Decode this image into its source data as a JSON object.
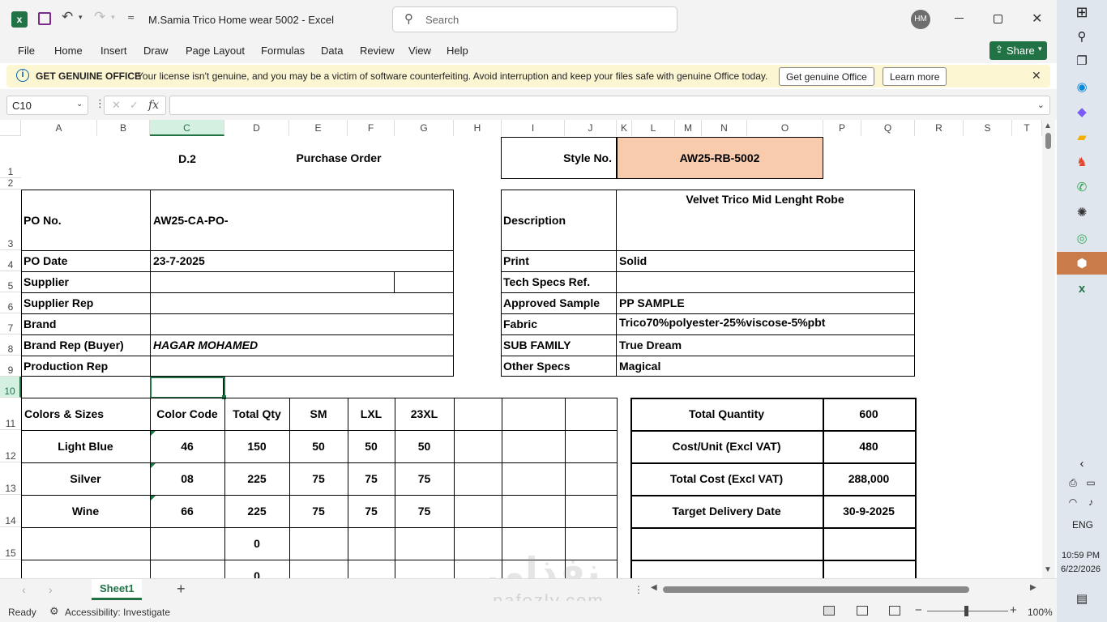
{
  "window": {
    "title": "M.Samia Trico Home wear 5002  -  Excel",
    "search_placeholder": "Search",
    "avatar": "HM"
  },
  "menu": [
    "File",
    "Home",
    "Insert",
    "Draw",
    "Page Layout",
    "Formulas",
    "Data",
    "Review",
    "View",
    "Help"
  ],
  "share_label": "Share",
  "infobar": {
    "heading": "GET GENUINE OFFICE",
    "message": "Your license isn't genuine, and you may be a victim of software counterfeiting. Avoid interruption and keep your files safe with genuine Office today.",
    "btn_genuine": "Get genuine Office",
    "btn_learn": "Learn more"
  },
  "formula": {
    "cell_ref": "C10",
    "fx": "fx",
    "value": ""
  },
  "columns": [
    "A",
    "B",
    "C",
    "D",
    "E",
    "F",
    "G",
    "H",
    "I",
    "J",
    "K",
    "L",
    "M",
    "N",
    "O",
    "P",
    "Q",
    "R",
    "S",
    "T"
  ],
  "rows": [
    "1",
    "2",
    "3",
    "4",
    "5",
    "6",
    "7",
    "8",
    "9",
    "10",
    "11",
    "12",
    "13",
    "14",
    "15"
  ],
  "sheet": {
    "d2": "D.2",
    "po_title": "Purchase Order",
    "style_label": "Style No.",
    "style_value": "AW25-RB-5002",
    "po_no_label": "PO No.",
    "po_no_value": "AW25-CA-PO-",
    "po_date_label": "PO Date",
    "po_date_value": "23-7-2025",
    "supplier_label": "Supplier",
    "supplier_rep_label": "Supplier Rep",
    "brand_label": "Brand",
    "brand_rep_label": "Brand Rep (Buyer)",
    "brand_rep_value": "HAGAR MOHAMED",
    "production_rep_label": "Production Rep",
    "desc_label": "Description",
    "desc_value": "Velvet Trico Mid Lenght Robe",
    "print_label": "Print",
    "print_value": "Solid",
    "tech_label": "Tech Specs Ref.",
    "approved_label": "Approved Sample",
    "approved_value": "PP SAMPLE",
    "fabric_label": "Fabric",
    "fabric_value": "Trico70%polyester-25%viscose-5%pbt",
    "subfamily_label": "SUB FAMILY",
    "subfamily_value": "True Dream",
    "other_label": "Other Specs",
    "other_value": "Magical",
    "table_headers": [
      "Colors & Sizes",
      "Color Code",
      "Total Qty",
      "SM",
      "LXL",
      "23XL"
    ],
    "table_rows": [
      [
        "Light Blue",
        "46",
        "150",
        "50",
        "50",
        "50"
      ],
      [
        "Silver",
        "08",
        "225",
        "75",
        "75",
        "75"
      ],
      [
        "Wine",
        "66",
        "225",
        "75",
        "75",
        "75"
      ],
      [
        "",
        "",
        "0",
        "",
        "",
        ""
      ],
      [
        "",
        "",
        "0",
        "",
        "",
        ""
      ]
    ],
    "summary": [
      [
        "Total Quantity",
        "600"
      ],
      [
        "Cost/Unit (Excl VAT)",
        "480"
      ],
      [
        "Total Cost (Excl VAT)",
        "288,000"
      ],
      [
        "Target Delivery Date",
        "30-9-2025"
      ]
    ]
  },
  "sheet_tab": "Sheet1",
  "status": {
    "ready": "Ready",
    "accessibility": "Accessibility: Investigate",
    "zoom": "100%"
  },
  "taskbar": {
    "lang": "ENG",
    "time": "10:59 PM",
    "date": "6/22/2026"
  },
  "watermark": {
    "arabic": "نفذلي",
    "latin": "nafezly.com"
  },
  "colors": {
    "style_fill": "#f8cbad",
    "excel_green": "#217346",
    "info_bg": "#fdf6d3"
  }
}
